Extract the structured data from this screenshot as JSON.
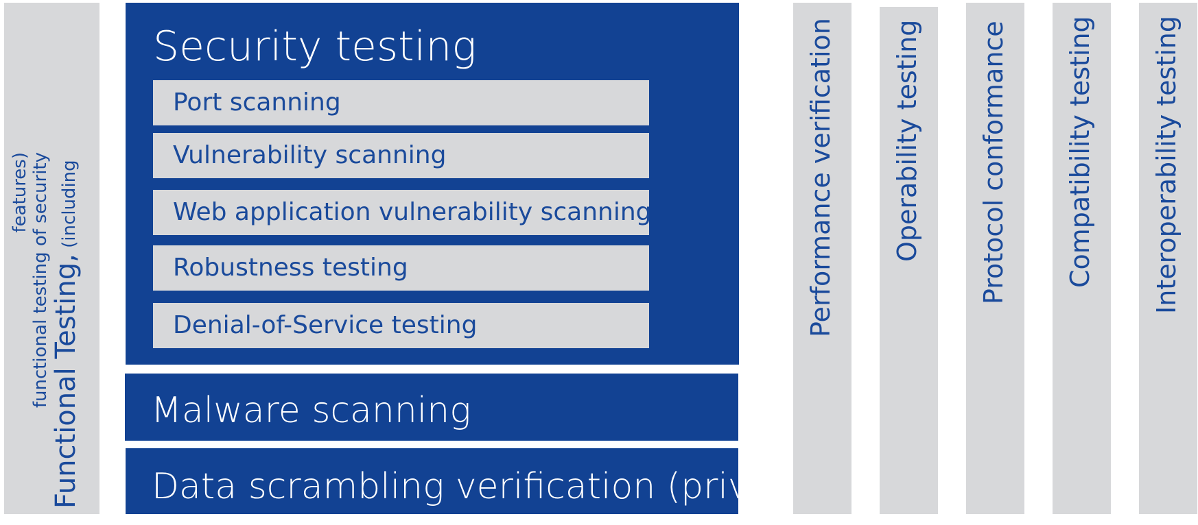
{
  "functional": {
    "main": "Functional Testing,",
    "inline": " (including",
    "sub1": "functional testing of security",
    "sub2": "features)"
  },
  "security": {
    "title": "Security testing",
    "items": [
      "Port scanning",
      "Vulnerability scanning",
      "Web application vulnerability scanning",
      "Robustness testing",
      "Denial-of-Service testing"
    ]
  },
  "malware": "Malware scanning",
  "data_scrambling": "Data scrambling verification (privacy)",
  "columns": [
    "Performance verification",
    "Operability testing",
    "Protocol conformance",
    "Compatibility testing",
    "Interoperability testing"
  ],
  "colors": {
    "primary_blue": "#124293",
    "text_blue": "#1a4a9b",
    "gray": "#d7d8da",
    "white": "#ffffff"
  }
}
